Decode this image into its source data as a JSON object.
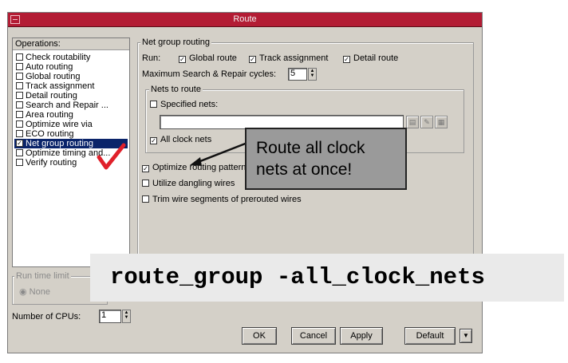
{
  "window": {
    "title": "Route"
  },
  "operations": {
    "header": "Operations:",
    "items": [
      {
        "label": "Check routability",
        "checked": false
      },
      {
        "label": "Auto routing",
        "checked": false
      },
      {
        "label": "Global routing",
        "checked": false
      },
      {
        "label": "Track assignment",
        "checked": false
      },
      {
        "label": "Detail routing",
        "checked": false
      },
      {
        "label": "Search and Repair ...",
        "checked": false
      },
      {
        "label": "Area routing",
        "checked": false
      },
      {
        "label": "Optimize wire via",
        "checked": false
      },
      {
        "label": "ECO routing",
        "checked": false
      },
      {
        "label": "Net group routing",
        "checked": true,
        "selected": true
      },
      {
        "label": "Optimize timing and...",
        "checked": false
      },
      {
        "label": "Verify routing",
        "checked": false
      }
    ]
  },
  "net_group": {
    "title": "Net group routing",
    "run_label": "Run:",
    "global_route": "Global route",
    "track_assignment": "Track assignment",
    "detail_route": "Detail route",
    "max_cycles_label": "Maximum Search & Repair cycles:",
    "max_cycles_value": "5",
    "nets_to_route": {
      "title": "Nets to route",
      "specified_nets": "Specified nets:",
      "specified_value": "",
      "all_clock_nets": "All clock nets"
    },
    "optimize_pattern": "Optimize routing patterns",
    "utilize_dangling": "Utilize dangling wires",
    "trim_wire": "Trim wire segments of prerouted wires"
  },
  "run_time": {
    "title": "Run time limit",
    "none": "None"
  },
  "cpus": {
    "label": "Number of CPUs:",
    "value": "1"
  },
  "buttons": {
    "ok": "OK",
    "cancel": "Cancel",
    "apply": "Apply",
    "default": "Default"
  },
  "callout": {
    "line1": "Route all clock",
    "line2": "nets at once!"
  },
  "command": "route_group -all_clock_nets",
  "colors": {
    "titlebar": "#b31c34",
    "selection": "#0a246a",
    "checkmark": "#e0202a",
    "callout": "#9a9a9a"
  }
}
